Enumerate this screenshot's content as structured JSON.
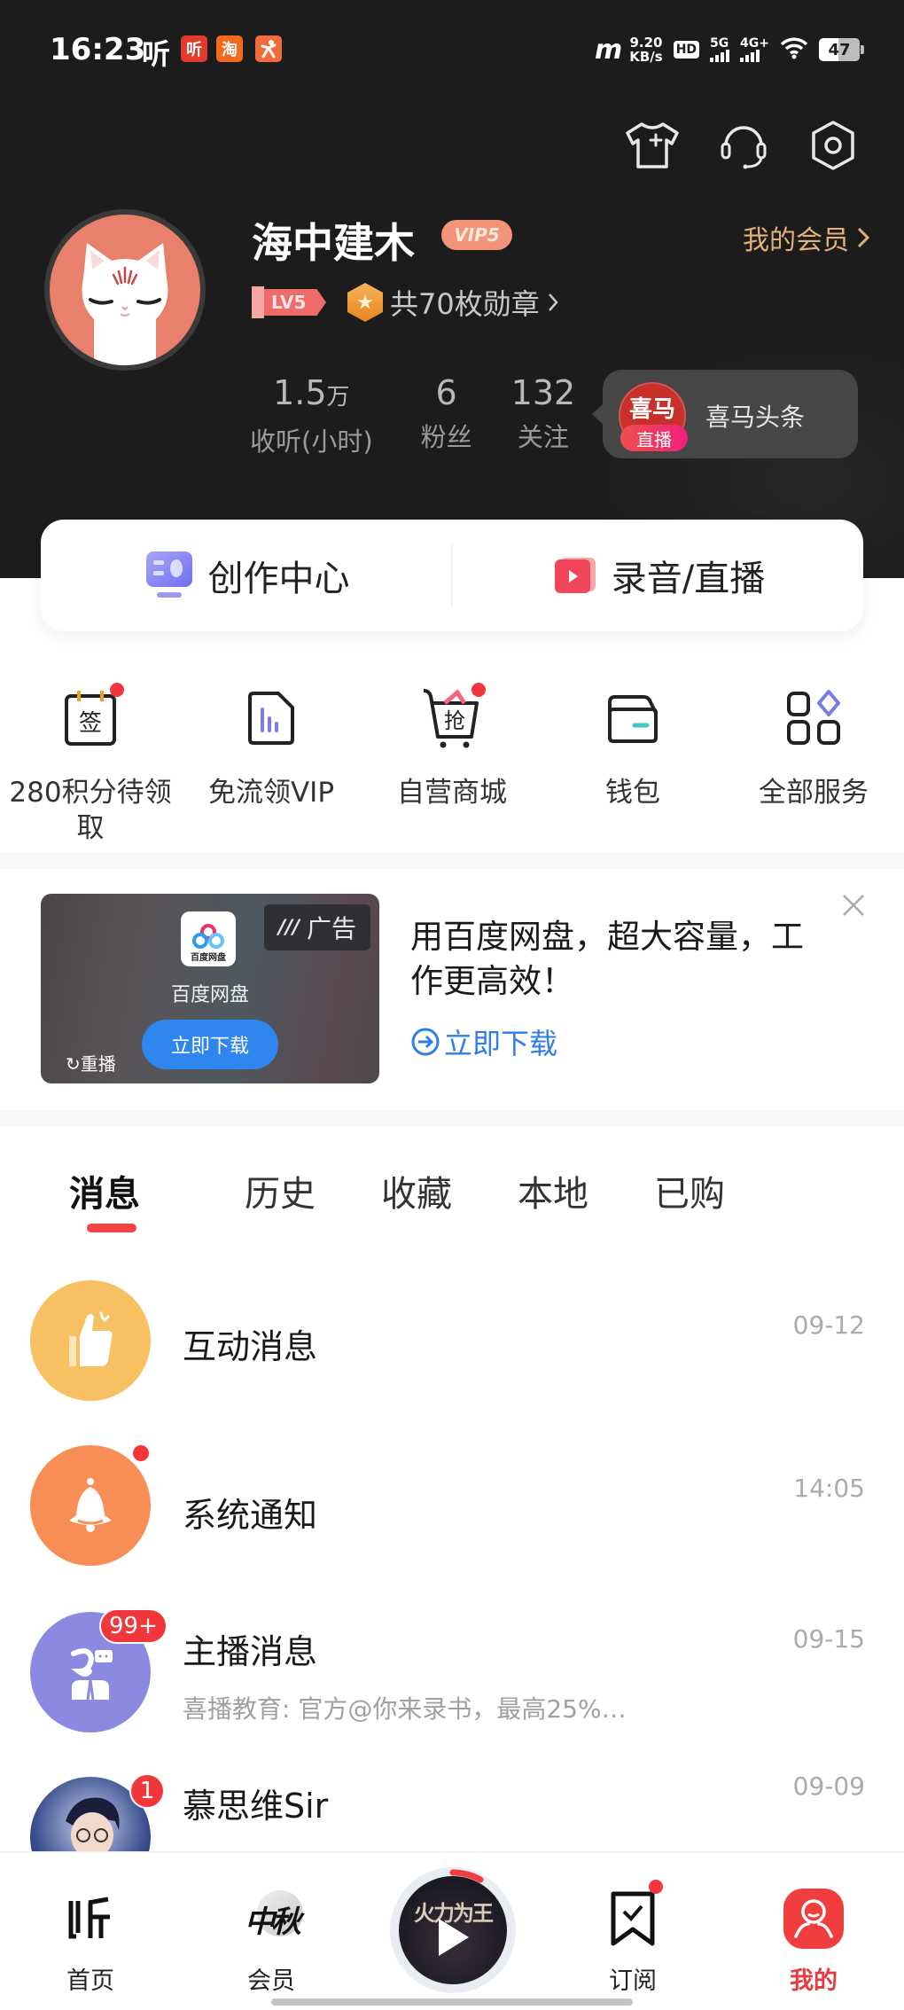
{
  "status_bar": {
    "time": "16:23",
    "notif_glyph": "听",
    "app_icons": [
      {
        "name": "ximalaya-app-icon",
        "glyph": "听",
        "color": "#e23a2c"
      },
      {
        "name": "taobao-app-icon",
        "glyph": "淘",
        "color": "#f36a1f"
      },
      {
        "name": "fitness-app-icon",
        "glyph": "ᴥ",
        "color": "#f26b3a"
      }
    ],
    "speed_value": "9.20",
    "speed_unit": "KB/s",
    "hd_label": "HD",
    "sim_label": "5G",
    "sim2_label": "4G+",
    "battery": "47"
  },
  "header": {
    "icons": [
      "tshirt-icon",
      "headset-icon",
      "settings-icon"
    ]
  },
  "profile": {
    "username": "海中建木",
    "vip_badge": "VIP5",
    "my_member": "我的会员",
    "level": "LV5",
    "medals": "共70枚勋章",
    "stats": [
      {
        "value": "1.5",
        "unit": "万",
        "label": "收听(小时)"
      },
      {
        "value": "6",
        "unit": "",
        "label": "粉丝"
      },
      {
        "value": "132",
        "unit": "",
        "label": "关注"
      }
    ],
    "live_popup": {
      "logo_text": "喜马",
      "tag": "直播",
      "name": "喜马头条"
    }
  },
  "create_card": {
    "left": "创作中心",
    "right": "录音/直播"
  },
  "services": [
    {
      "label": "280积分待领取",
      "icon": "sign-in-calendar-icon",
      "dot": true
    },
    {
      "label": "免流领VIP",
      "icon": "sim-card-icon",
      "dot": false
    },
    {
      "label": "自营商城",
      "icon": "shopping-cart-icon",
      "dot": true
    },
    {
      "label": "钱包",
      "icon": "wallet-icon",
      "dot": false
    },
    {
      "label": "全部服务",
      "icon": "all-services-icon",
      "dot": false
    }
  ],
  "ad": {
    "app_icon_text": "百度网盘",
    "app_name": "百度网盘",
    "tag": "广告",
    "download_button": "立即下载",
    "replay": "重播",
    "title": "用百度网盘，超大容量，工作更高效！",
    "cta": "立即下载"
  },
  "tabs": [
    {
      "label": "消息",
      "active": true
    },
    {
      "label": "历史",
      "active": false
    },
    {
      "label": "收藏",
      "active": false
    },
    {
      "label": "本地",
      "active": false
    },
    {
      "label": "已购",
      "active": false
    }
  ],
  "messages": [
    {
      "title": "互动消息",
      "subtitle": "",
      "time": "09-12",
      "badge": "",
      "dot": false,
      "avatar_color": "#f7c163",
      "icon": "thumbs-up-icon"
    },
    {
      "title": "系统通知",
      "subtitle": "",
      "time": "14:05",
      "badge": "",
      "dot": true,
      "avatar_color": "#f88e56",
      "icon": "bell-icon"
    },
    {
      "title": "主播消息",
      "subtitle": "喜播教育: 官方@你来录书，最高25%…",
      "time": "09-15",
      "badge": "99+",
      "dot": false,
      "avatar_color": "#8a8ae0",
      "icon": "anchor-chat-icon"
    },
    {
      "title": "慕思维Sir",
      "subtitle": "",
      "time": "09-09",
      "badge": "1",
      "dot": false,
      "avatar_color": "#3a4e8c",
      "icon": "user-avatar-image"
    }
  ],
  "bottom_nav": {
    "items": [
      {
        "label": "首页",
        "icon": "home-listen-icon",
        "active": false
      },
      {
        "label": "会员",
        "icon": "mid-autumn-member-icon",
        "active": false
      },
      {
        "label": "订阅",
        "icon": "subscribe-bookmark-icon",
        "active": false,
        "dot": true
      },
      {
        "label": "我的",
        "icon": "profile-icon",
        "active": true
      }
    ],
    "player_title": "火力为王"
  },
  "colors": {
    "accent_red": "#f24444",
    "vip_gold": "#e3b07a",
    "link_blue": "#2f7ee6"
  }
}
